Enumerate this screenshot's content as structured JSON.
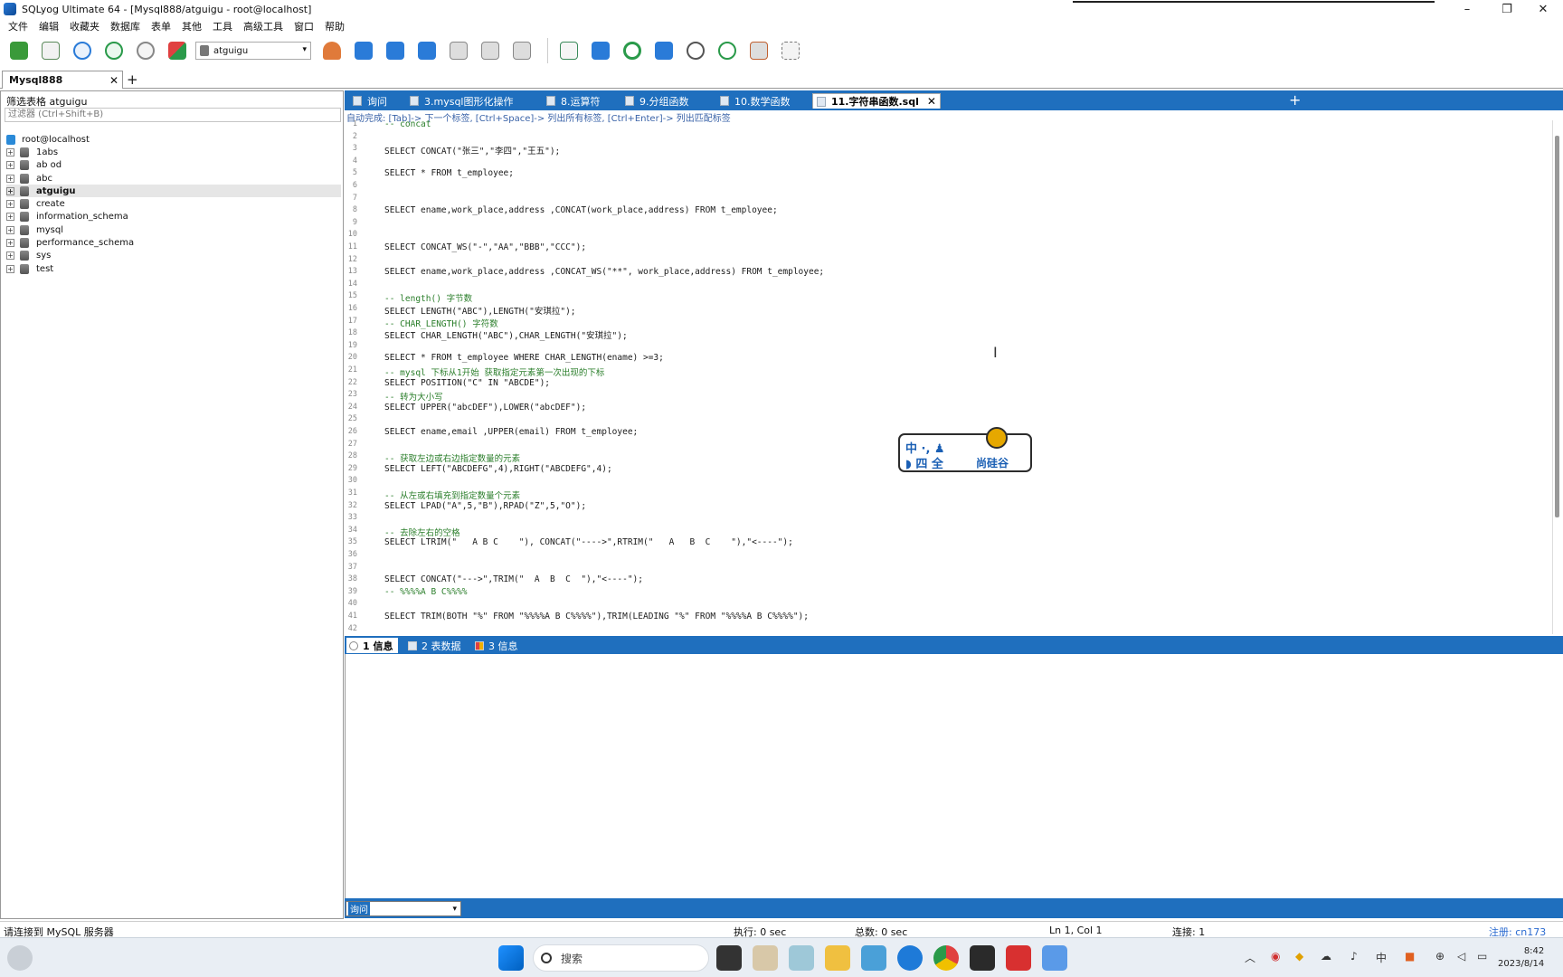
{
  "window": {
    "title": "SQLyog Ultimate 64 - [Mysql888/atguigu - root@localhost]"
  },
  "menu": [
    "文件",
    "编辑",
    "收藏夹",
    "数据库",
    "表单",
    "其他",
    "工具",
    "高级工具",
    "窗口",
    "帮助"
  ],
  "toolbar": {
    "db_selected": "atguigu"
  },
  "connection_tab": {
    "label": "Mysql888"
  },
  "object_browser": {
    "filter_title": "筛选表格 atguigu",
    "filter_placeholder": "过滤器 (Ctrl+Shift+B)",
    "root": "root@localhost",
    "databases": [
      "1abs",
      "ab od",
      "abc",
      "atguigu",
      "create",
      "information_schema",
      "mysql",
      "performance_schema",
      "sys",
      "test"
    ],
    "selected": "atguigu"
  },
  "query_tabs": [
    {
      "label": "询问"
    },
    {
      "label": "3.mysql图形化操作"
    },
    {
      "label": "8.运算符"
    },
    {
      "label": "9.分组函数"
    },
    {
      "label": "10.数学函数"
    },
    {
      "label": "11.字符串函数.sql",
      "active": true
    }
  ],
  "hint": "自动完成: [Tab]-> 下一个标签, [Ctrl+Space]-> 列出所有标签, [Ctrl+Enter]-> 列出匹配标签",
  "editor": {
    "lines": [
      {
        "n": "1",
        "t": "-- concat",
        "c": true
      },
      {
        "n": "2",
        "t": ""
      },
      {
        "n": "3",
        "t": "SELECT CONCAT(\"张三\",\"李四\",\"王五\");"
      },
      {
        "n": "4",
        "t": ""
      },
      {
        "n": "5",
        "t": "SELECT * FROM t_employee;"
      },
      {
        "n": "6",
        "t": ""
      },
      {
        "n": "7",
        "t": ""
      },
      {
        "n": "8",
        "t": "SELECT ename,work_place,address ,CONCAT(work_place,address) FROM t_employee;"
      },
      {
        "n": "9",
        "t": ""
      },
      {
        "n": "10",
        "t": ""
      },
      {
        "n": "11",
        "t": "SELECT CONCAT_WS(\"-\",\"AA\",\"BBB\",\"CCC\");"
      },
      {
        "n": "12",
        "t": ""
      },
      {
        "n": "13",
        "t": "SELECT ename,work_place,address ,CONCAT_WS(\"**\", work_place,address) FROM t_employee;"
      },
      {
        "n": "14",
        "t": ""
      },
      {
        "n": "15",
        "t": "-- length() 字节数",
        "c": true
      },
      {
        "n": "16",
        "t": "SELECT LENGTH(\"ABC\"),LENGTH(\"安琪拉\");"
      },
      {
        "n": "17",
        "t": "-- CHAR_LENGTH() 字符数",
        "c": true
      },
      {
        "n": "18",
        "t": "SELECT CHAR_LENGTH(\"ABC\"),CHAR_LENGTH(\"安琪拉\");"
      },
      {
        "n": "19",
        "t": ""
      },
      {
        "n": "20",
        "t": "SELECT * FROM t_employee WHERE CHAR_LENGTH(ename) >=3;"
      },
      {
        "n": "21",
        "t": "-- mysql 下标从1开始 获取指定元素第一次出现的下标",
        "c": true
      },
      {
        "n": "22",
        "t": "SELECT POSITION(\"C\" IN \"ABCDE\");"
      },
      {
        "n": "23",
        "t": "-- 转为大小写",
        "c": true
      },
      {
        "n": "24",
        "t": "SELECT UPPER(\"abcDEF\"),LOWER(\"abcDEF\");"
      },
      {
        "n": "25",
        "t": ""
      },
      {
        "n": "26",
        "t": "SELECT ename,email ,UPPER(email) FROM t_employee;"
      },
      {
        "n": "27",
        "t": ""
      },
      {
        "n": "28",
        "t": "-- 获取左边或右边指定数量的元素",
        "c": true
      },
      {
        "n": "29",
        "t": "SELECT LEFT(\"ABCDEFG\",4),RIGHT(\"ABCDEFG\",4);"
      },
      {
        "n": "30",
        "t": ""
      },
      {
        "n": "31",
        "t": "-- 从左或右填充到指定数量个元素",
        "c": true
      },
      {
        "n": "32",
        "t": "SELECT LPAD(\"A\",5,\"B\"),RPAD(\"Z\",5,\"O\");"
      },
      {
        "n": "33",
        "t": ""
      },
      {
        "n": "34",
        "t": "-- 去除左右的空格",
        "c": true
      },
      {
        "n": "35",
        "t": "SELECT LTRIM(\"   A B C    \"), CONCAT(\"---->\",RTRIM(\"   A   B  C    \"),\"<----\");"
      },
      {
        "n": "36",
        "t": ""
      },
      {
        "n": "37",
        "t": ""
      },
      {
        "n": "38",
        "t": "SELECT CONCAT(\"--->\",TRIM(\"  A  B  C  \"),\"<----\");"
      },
      {
        "n": "39",
        "t": "-- %%%%A B C%%%%",
        "c": true
      },
      {
        "n": "40",
        "t": ""
      },
      {
        "n": "41",
        "t": "SELECT TRIM(BOTH \"%\" FROM \"%%%%A B C%%%%\"),TRIM(LEADING \"%\" FROM \"%%%%A B C%%%%\");"
      },
      {
        "n": "42",
        "t": ""
      }
    ]
  },
  "ime": {
    "mode": "中 ·, ♟",
    "width": "◗ 四 全",
    "brand": "尚硅谷"
  },
  "result_tabs": [
    {
      "label": "1 信息",
      "active": true
    },
    {
      "label": "2 表数据"
    },
    {
      "label": "3 信息"
    }
  ],
  "output_select": "询问",
  "status": {
    "left": "请连接到 MySQL 服务器",
    "exec": "执行: 0 sec",
    "total": "总数: 0 sec",
    "pos": "Ln 1, Col 1",
    "conn": "连接: 1",
    "reg": "注册: cn173"
  },
  "taskbar": {
    "search": "搜索",
    "ime_cn": "中",
    "time": "8:42",
    "date": "2023/8/14"
  },
  "colors": {
    "accent": "#1f6fbe",
    "comment": "#2a7e2a",
    "keyword": "#2e5bb0",
    "string": "#c81e1e"
  }
}
